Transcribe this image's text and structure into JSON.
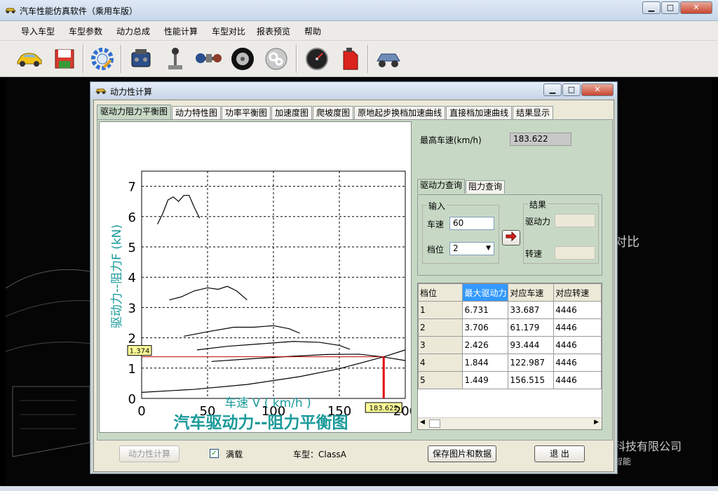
{
  "window": {
    "title": "汽车性能仿真软件（乘用车版）",
    "min_label": "▁",
    "max_label": "□",
    "close_label": "✕"
  },
  "menu": [
    "导入车型",
    "车型参数",
    "动力总成",
    "性能计算",
    "车型对比",
    "报表预览",
    "帮助"
  ],
  "toolbar": {
    "buttons": [
      "car-icon",
      "save-icon",
      "settings-icon",
      "engine-icon",
      "gear-shifter-icon",
      "drivetrain-icon",
      "tire-icon",
      "gears-icon",
      "speedometer-icon",
      "fuel-can-icon",
      "chassis-icon"
    ]
  },
  "background": {
    "text1": "对比",
    "text2": "科技有限公司",
    "text3": "智能"
  },
  "dialog": {
    "title": "动力性计算",
    "tabs": [
      "驱动力阻力平衡图",
      "动力特性图",
      "功率平衡图",
      "加速度图",
      "爬坡度图",
      "原地起步换档加速曲线",
      "直接档加速曲线",
      "结果显示"
    ],
    "max_speed_label": "最高车速(km/h)",
    "max_speed_value": "183.622",
    "query_tabs": [
      "驱动力查询",
      "阻力查询"
    ],
    "input_group": "输入",
    "result_group": "结果",
    "speed_label": "车速",
    "speed_value": "60",
    "gear_label": "档位",
    "gear_value": "2",
    "force_label": "驱动力",
    "rpm_label": "转速",
    "table": {
      "headers": [
        "档位",
        "最大驱动力",
        "对应车速",
        "对应转速"
      ],
      "rows": [
        [
          "1",
          "6.731",
          "33.687",
          "4446"
        ],
        [
          "2",
          "3.706",
          "61.179",
          "4446"
        ],
        [
          "3",
          "2.426",
          "93.444",
          "4446"
        ],
        [
          "4",
          "1.844",
          "122.987",
          "4446"
        ],
        [
          "5",
          "1.449",
          "156.515",
          "4446"
        ]
      ]
    },
    "calc_button": "动力性计算",
    "full_load_label": "满载",
    "model_label": "车型：ClassA",
    "save_button": "保存图片和数据",
    "exit_button": "退  出"
  },
  "chart_data": {
    "type": "line",
    "title": "汽车驱动力--阻力平衡图",
    "xlabel": "车速 V   ( km/h )",
    "ylabel": "驱动力--阻力F  (kN)",
    "xlim": [
      0,
      200
    ],
    "ylim": [
      0,
      7.5
    ],
    "xticks": [
      0,
      50,
      100,
      150,
      200
    ],
    "yticks": [
      0,
      1,
      2,
      3,
      4,
      5,
      6,
      7
    ],
    "grid": true,
    "series": [
      {
        "x": [
          12,
          16,
          20,
          24,
          28,
          32,
          36,
          40,
          44
        ],
        "y": [
          5.75,
          6.1,
          6.55,
          6.65,
          6.5,
          6.7,
          6.7,
          6.3,
          5.95
        ]
      },
      {
        "x": [
          21,
          30,
          40,
          50,
          58,
          65,
          72,
          80
        ],
        "y": [
          3.25,
          3.35,
          3.55,
          3.65,
          3.6,
          3.7,
          3.55,
          3.25
        ]
      },
      {
        "x": [
          32,
          50,
          70,
          85,
          100,
          112,
          120
        ],
        "y": [
          2.05,
          2.2,
          2.35,
          2.35,
          2.4,
          2.3,
          2.15
        ]
      },
      {
        "x": [
          42,
          65,
          90,
          115,
          135,
          150,
          158
        ],
        "y": [
          1.6,
          1.72,
          1.8,
          1.88,
          1.85,
          1.75,
          1.62
        ]
      },
      {
        "x": [
          53,
          80,
          110,
          140,
          165,
          183,
          200
        ],
        "y": [
          1.22,
          1.3,
          1.38,
          1.45,
          1.46,
          1.37,
          1.25
        ]
      },
      {
        "x": [
          0,
          40,
          80,
          120,
          150,
          183.622,
          200
        ],
        "y": [
          0.2,
          0.3,
          0.46,
          0.72,
          0.98,
          1.374,
          1.6
        ]
      }
    ],
    "annotations": {
      "y_marker": "1.374",
      "x_marker": "183.622",
      "marker_x": 183.622,
      "marker_y": 1.374
    }
  }
}
